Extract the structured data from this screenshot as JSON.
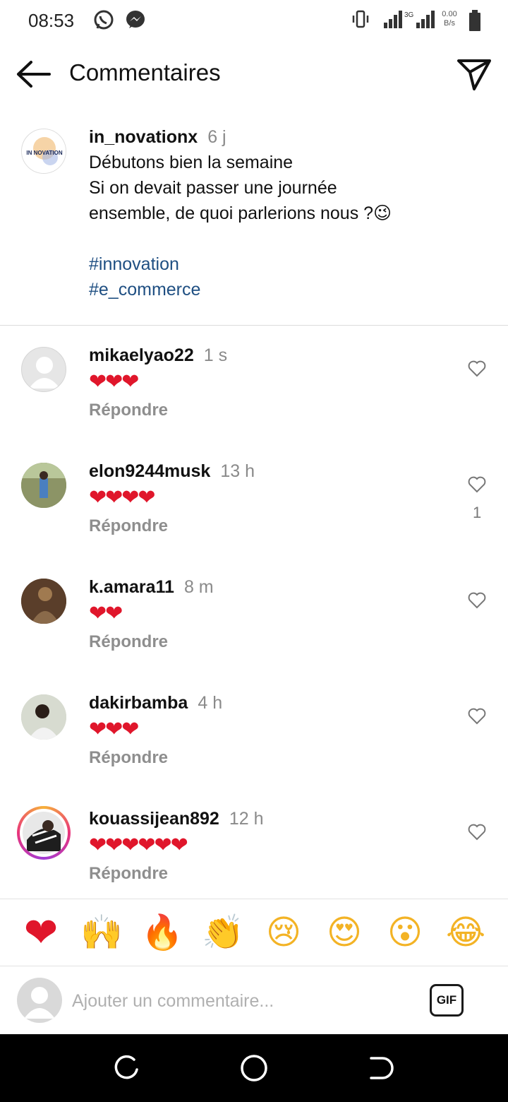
{
  "status_bar": {
    "time": "08:53",
    "icons": [
      "whatsapp-icon",
      "messenger-icon",
      "vibrate-icon",
      "signal-icon",
      "signal-3g-icon",
      "battery-icon"
    ],
    "network_label": "3G",
    "speed_value": "0.00",
    "speed_unit": "B/s"
  },
  "header": {
    "title": "Commentaires",
    "back_icon": "arrow-left-icon",
    "share_icon": "send-icon"
  },
  "caption": {
    "username": "in_novationx",
    "time": "6 j",
    "lines": [
      "Débutons bien la semaine",
      "Si on devait passer une journée",
      "ensemble, de quoi parlerions nous ?😉"
    ],
    "hashtags": [
      "#innovation",
      "#e_commerce"
    ],
    "avatar_text": "IN NOVATION"
  },
  "comments": [
    {
      "username": "mikaelyao22",
      "time": "1 s",
      "text": "❤❤❤",
      "reply": "Répondre",
      "likes": ""
    },
    {
      "username": "elon9244musk",
      "time": "13 h",
      "text": "❤❤❤❤",
      "reply": "Répondre",
      "likes": "1"
    },
    {
      "username": "k.amara11",
      "time": "8 m",
      "text": "❤❤",
      "reply": "Répondre",
      "likes": ""
    },
    {
      "username": "dakirbamba",
      "time": "4 h",
      "text": "❤❤❤",
      "reply": "Répondre",
      "likes": ""
    },
    {
      "username": "kouassijean892",
      "time": "12 h",
      "text": "❤❤❤❤❤❤",
      "reply": "Répondre",
      "likes": ""
    }
  ],
  "emoji_bar": [
    "❤",
    "🙌",
    "🔥",
    "👏",
    "😢",
    "😍",
    "😮",
    "😂"
  ],
  "comment_input": {
    "placeholder": "Ajouter un commentaire...",
    "gif_label": "GIF"
  },
  "colors": {
    "heart": "#e0162b",
    "hashtag": "#1f4f82",
    "muted": "#8e8e8e"
  }
}
